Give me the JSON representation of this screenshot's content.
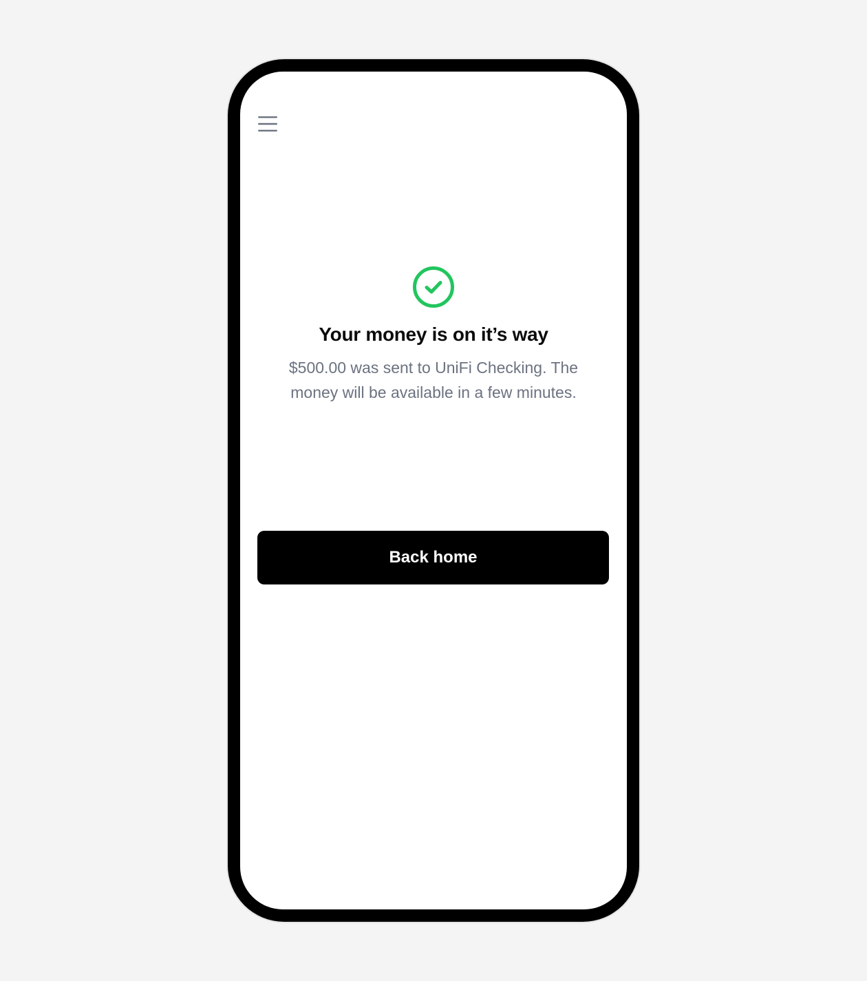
{
  "header": {
    "menu_icon": "hamburger-menu-icon"
  },
  "confirmation": {
    "status_icon": "check-circle-icon",
    "title": "Your money is on it’s way",
    "message": "$500.00 was sent to UniFi Checking. The money will be available in a few minutes."
  },
  "actions": {
    "back_home_label": "Back home"
  },
  "colors": {
    "page_background": "#f4f4f4",
    "device_frame": "#000000",
    "screen_background": "#ffffff",
    "success": "#22c55e",
    "title_text": "#0b0b0b",
    "secondary_text": "#6b7280",
    "menu_icon": "#6b7280",
    "primary_button": "#000000",
    "primary_button_text": "#ffffff"
  }
}
